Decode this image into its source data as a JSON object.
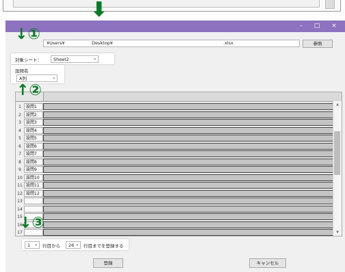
{
  "dialog": {
    "path_user": "¥Users¥",
    "path_desktop": "Desktop¥",
    "file_ext": ".xlsx",
    "browse_label": "参照",
    "sheet_label": "対象シート：",
    "sheet_value": "Sheet2",
    "question_label": "設問名",
    "question_value": "A列",
    "start_row": "1",
    "from_label": "行目から",
    "end_row": "26",
    "to_label": "行目までを登録する",
    "register_label": "登録",
    "cancel_label": "キャンセル"
  },
  "window_controls": {
    "minimize": "–",
    "maximize": "□",
    "close": "×"
  },
  "rows": [
    {
      "num": "1",
      "name": "設問1"
    },
    {
      "num": "2",
      "name": "設問2"
    },
    {
      "num": "3",
      "name": "設問3"
    },
    {
      "num": "4",
      "name": "設問4"
    },
    {
      "num": "5",
      "name": "設問5"
    },
    {
      "num": "6",
      "name": "設問6"
    },
    {
      "num": "7",
      "name": "設問7"
    },
    {
      "num": "8",
      "name": "設問8"
    },
    {
      "num": "9",
      "name": "設問9"
    },
    {
      "num": "10",
      "name": "設問10"
    },
    {
      "num": "11",
      "name": "設問11"
    },
    {
      "num": "12",
      "name": "設問12"
    },
    {
      "num": "13",
      "name": ""
    },
    {
      "num": "14",
      "name": ""
    },
    {
      "num": "15",
      "name": ""
    },
    {
      "num": "16",
      "name": ""
    },
    {
      "num": "17",
      "name": ""
    }
  ],
  "annotations": {
    "a1": "↓①",
    "a2": "↑②",
    "a3": "↓③",
    "top_arrow": "⬇"
  },
  "colors": {
    "titlebar": "#8d72c0",
    "annotation": "#0b7a28"
  }
}
